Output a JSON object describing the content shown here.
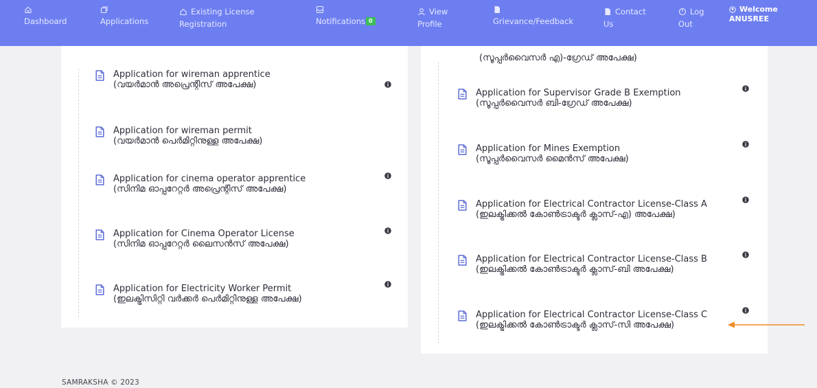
{
  "nav": {
    "dashboard": "Dashboard",
    "applications": "Applications",
    "existing_license_1": "Existing License",
    "existing_license_2": "Registration",
    "notifications": "Notifications",
    "notifications_count": "0",
    "view_profile_1": "View",
    "view_profile_2": "Profile",
    "grievance": "Grievance/Feedback",
    "contact_1": "Contact",
    "contact_2": "Us",
    "logout_1": "Log",
    "logout_2": "Out",
    "welcome_1": "Welcome",
    "welcome_2": "ANUSREE"
  },
  "left_items": [
    {
      "en": "Application for wireman apprentice",
      "ml": "(വയർമാൻ അപ്രെന്റിസ് അപേക്ഷ)",
      "info": true
    },
    {
      "en": "Application for wireman permit",
      "ml": "(വയർമാൻ പെർമിറ്റിനുള്ള അപേക്ഷ)",
      "info": false
    },
    {
      "en": "Application for cinema operator apprentice",
      "ml": "(സിനിമ ഓപ്പറേറ്റർ അപ്രെന്റിസ് അപേക്ഷ)",
      "info": true
    },
    {
      "en": "Application for Cinema Operator License",
      "ml": "(സിനിമ ഓപ്പറേറ്റർ ലൈസൻസ് അപേക്ഷ)",
      "info": true
    },
    {
      "en": "Application for Electricity Worker Permit",
      "ml": "(ഇലക്ട്രിസിറ്റി വർക്കർ പെർമിറ്റിനുള്ള അപേക്ഷ)",
      "info": true
    }
  ],
  "right_partial": "(സൂപ്പർവൈസർ എ)-ഗ്രേഡ് അപേക്ഷ)",
  "right_items": [
    {
      "en": "Application for Supervisor Grade B Exemption",
      "ml": "(സൂപ്പർവൈസർ ബി-ഗ്രേഡ് അപേക്ഷ)",
      "info": true
    },
    {
      "en": "Application for Mines Exemption",
      "ml": "(സൂപ്പർവൈസർ മൈൻസ് അപേക്ഷ)",
      "info": true
    },
    {
      "en": "Application for Electrical Contractor License-Class A",
      "ml": "(ഇലക്ട്രിക്കൽ കോൺട്രാക്ടർ ക്ലാസ്-എ) അപേക്ഷ)",
      "info": true
    },
    {
      "en": "Application for Electrical Contractor License-Class B",
      "ml": "(ഇലക്ട്രിക്കൽ കോൺട്രാക്ടർ ക്ലാസ്-ബി അപേക്ഷ)",
      "info": true
    },
    {
      "en": "Application for Electrical Contractor License-Class C",
      "ml": "(ഇലക്ട്രിക്കൽ കോൺട്രാക്ടർ ക്ലാസ്-സി അപേക്ഷ)",
      "info": true
    }
  ],
  "footer": "SAMRAKSHA © 2023",
  "colors": {
    "nav_bg": "#6d7ef0",
    "icon": "#5b6cd6",
    "badge": "#3cbf56",
    "arrow": "#f08a24"
  }
}
